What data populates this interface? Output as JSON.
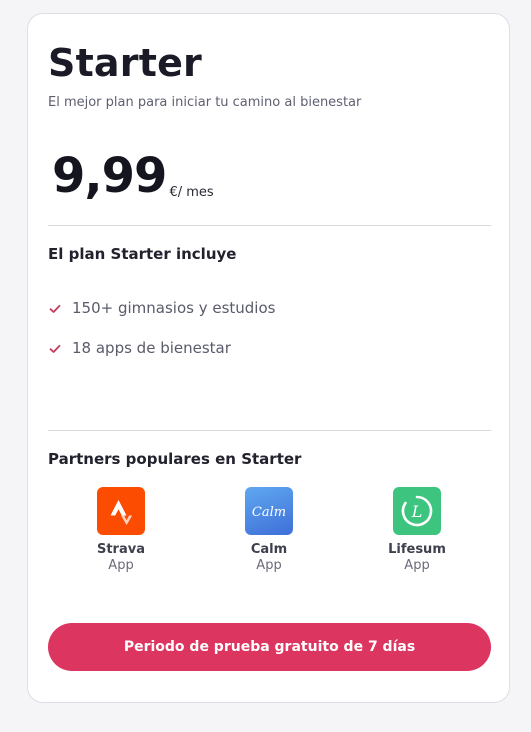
{
  "plan": {
    "title": "Starter",
    "subtitle": "El mejor plan para iniciar tu camino al bienestar",
    "price": "9,99",
    "price_unit": "€/ mes"
  },
  "includes": {
    "heading": "El plan Starter incluye",
    "items": [
      {
        "label": "150+ gimnasios y estudios",
        "icon": "check-icon"
      },
      {
        "label": "18 apps de bienestar",
        "icon": "check-icon"
      }
    ]
  },
  "partners": {
    "heading": "Partners populares en Starter",
    "items": [
      {
        "name": "Strava",
        "type": "App",
        "icon": "strava-logo",
        "color": "#fc4c02"
      },
      {
        "name": "Calm",
        "type": "App",
        "icon": "calm-logo",
        "color": "#4a90e2"
      },
      {
        "name": "Lifesum",
        "type": "App",
        "icon": "lifesum-logo",
        "color": "#3dc47e"
      }
    ]
  },
  "cta": {
    "label": "Periodo de prueba gratuito de 7 días"
  },
  "colors": {
    "accent": "#dc3560",
    "check": "#c8385a"
  }
}
